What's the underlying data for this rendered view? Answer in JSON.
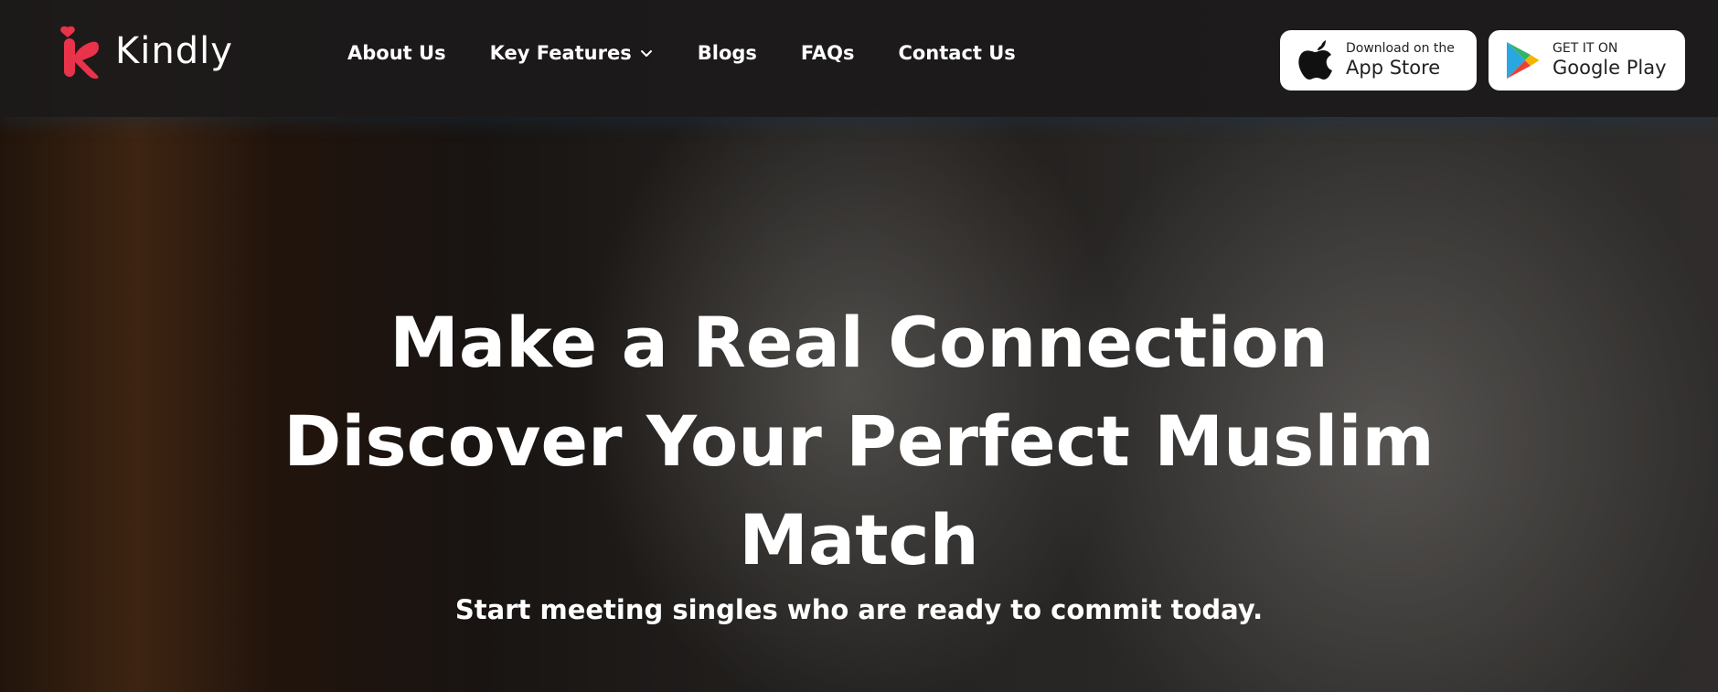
{
  "brand": {
    "name": "Kindly",
    "accent": "#e8334a"
  },
  "nav": {
    "items": [
      {
        "label": "About Us"
      },
      {
        "label": "Key Features"
      },
      {
        "label": "Blogs"
      },
      {
        "label": "FAQs"
      },
      {
        "label": "Contact Us"
      }
    ],
    "dropdown_icon": "chevron-down-icon"
  },
  "stores": {
    "apple": {
      "small": "Download on the",
      "big": "App Store",
      "icon": "apple-icon"
    },
    "google": {
      "small": "GET IT ON",
      "big": "Google Play",
      "icon": "google-play-icon"
    }
  },
  "hero": {
    "headline_lines": [
      "Make a Real Connection",
      "Discover Your Perfect Muslim",
      "Match"
    ],
    "subtitle": "Start meeting singles who are ready to commit today."
  }
}
